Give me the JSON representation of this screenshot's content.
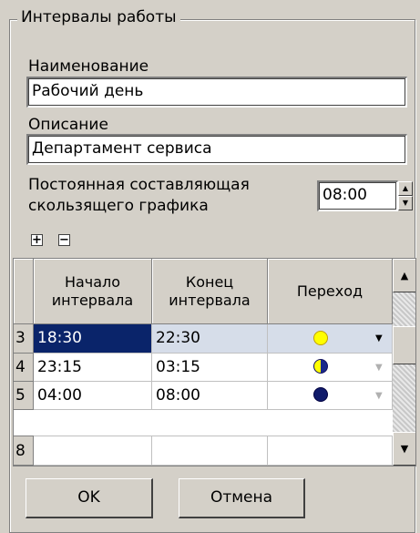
{
  "group": {
    "title": "Интервалы работы"
  },
  "name": {
    "label": "Наименование",
    "value": "Рабочий день"
  },
  "description": {
    "label": "Описание",
    "value": "Департамент сервиса"
  },
  "constant": {
    "label_line1": "Постоянная составляющая",
    "label_line2": "скользящего графика",
    "value": "08:00"
  },
  "toolbar": {
    "add_icon": "plus-box-icon",
    "remove_icon": "minus-box-icon"
  },
  "grid": {
    "columns": [
      "Начало интервала",
      "Конец интервала",
      "Переход"
    ],
    "rows": [
      {
        "num": "3",
        "start": "18:30",
        "end": "22:30",
        "transition_icon": "clock-yellow-icon"
      },
      {
        "num": "4",
        "start": "23:15",
        "end": "03:15",
        "transition_icon": "clock-half-icon"
      },
      {
        "num": "5",
        "start": "04:00",
        "end": "08:00",
        "transition_icon": "clock-dark-icon"
      }
    ],
    "last_row_num": "8"
  },
  "buttons": {
    "ok": "OK",
    "cancel": "Отмена"
  },
  "colors": {
    "selection": "#0a246a",
    "row_highlight": "#d6dde9",
    "window_bg": "#d4d0c8"
  }
}
